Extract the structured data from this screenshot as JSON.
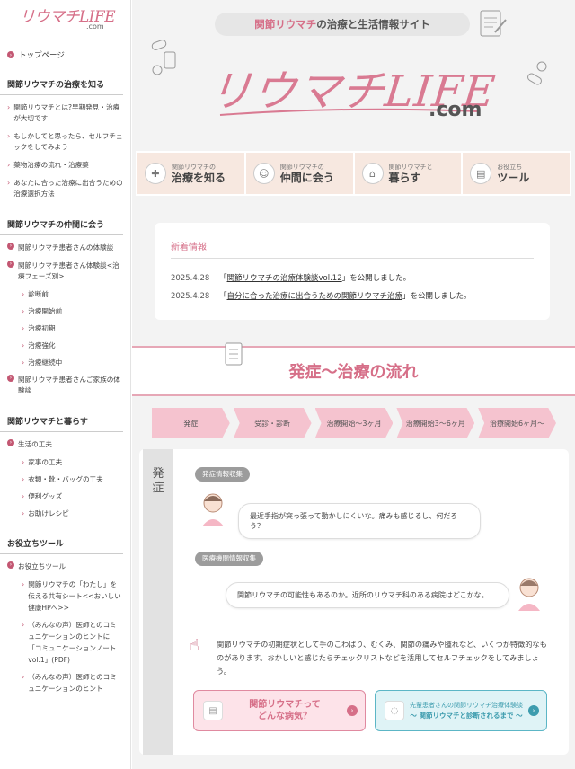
{
  "sidebar": {
    "logo": {
      "main": "リウマチLIFE",
      "suffix": ".com"
    },
    "top_link": "トップページ",
    "sections": [
      {
        "heading": "関節リウマチの治療を知る",
        "items": [
          "関節リウマチとは?早期発見・治療が大切です",
          "もしかしてと思ったら、セルフチェックをしてみよう",
          "薬物治療の流れ・治療薬",
          "あなたに合った治療に出合うための治療選択方法"
        ]
      },
      {
        "heading": "関節リウマチの仲間に会う",
        "dot_items": [
          "関節リウマチ患者さんの体験談",
          "関節リウマチ患者さん体験談<治療フェーズ別>"
        ],
        "sub_items": [
          "診断前",
          "治療開始前",
          "治療初期",
          "治療強化",
          "治療継続中"
        ],
        "dot_items_after": [
          "関節リウマチ患者さんご家族の体験談"
        ]
      },
      {
        "heading": "関節リウマチと暮らす",
        "dot_items": [
          "生活の工夫"
        ],
        "sub_items": [
          "家事の工夫",
          "衣類・靴・バッグの工夫",
          "便利グッズ",
          "お助けレシピ"
        ]
      },
      {
        "heading": "お役立ちツール",
        "dot_items": [
          "お役立ちツール"
        ],
        "sub_items": [
          "関節リウマチの「わたし」を伝える共有シート<<おいしい健康HPへ>>",
          "（みんなの声）医師とのコミュニケーションのヒントに「コミュニケーションノート vol.1」(PDF)",
          "（みんなの声）医師とのコミュニケーションのヒント"
        ]
      }
    ]
  },
  "header": {
    "tagline_pink": "関節リウマチ",
    "tagline_rest": "の治療と生活情報サイト",
    "logo_main": "リウマチLIFE",
    "logo_suffix": ".com"
  },
  "nav_tiles": [
    {
      "small": "関節リウマチの",
      "big": "治療を知る",
      "icon": "pill-icon"
    },
    {
      "small": "関節リウマチの",
      "big": "仲間に会う",
      "icon": "people-icon"
    },
    {
      "small": "関節リウマチと",
      "big": "暮らす",
      "icon": "house-icon"
    },
    {
      "small": "お役立ち",
      "big": "ツール",
      "icon": "document-icon"
    }
  ],
  "news": {
    "title": "新着情報",
    "items": [
      {
        "date": "2025.4.28",
        "open": "「",
        "link": "関節リウマチの治療体験談vol.12",
        "close": "」を公開しました。"
      },
      {
        "date": "2025.4.28",
        "open": "「",
        "link": "自分に合った治療に出合うための関節リウマチ治療",
        "close": "」を公開しました。"
      }
    ]
  },
  "flow": {
    "title": "発症〜治療の流れ",
    "steps": [
      "発症",
      "受診・診断",
      "治療開始〜3ヶ月",
      "治療開始3〜6ヶ月",
      "治療開始6ヶ月〜"
    ],
    "phase_label": "発症",
    "tag1": "発症情報収集",
    "bubble1": "最近手指が突っ張って動かしにくいな。痛みも感じるし、何だろう？",
    "tag2": "医療機関情報収集",
    "bubble2": "関節リウマチの可能性もあるのか。近所のリウマチ科のある病院はどこかな。",
    "info": "関節リウマチの初期症状として手のこわばり、むくみ、関節の痛みや腫れなど、いくつか特徴的なものがあります。おかしいと感じたらチェックリストなどを活用してセルフチェックをしてみましょう。",
    "btn_a": {
      "line1": "関節リウマチって",
      "line2": "どんな病気？"
    },
    "btn_b": {
      "line1": "先輩患者さんの関節リウマチ治療体験談",
      "line2": "〜 関節リウマチと診断されるまで 〜"
    }
  },
  "colors": {
    "accent": "#d66f88",
    "teal": "#3d9cae",
    "tile": "#f7e8e0",
    "step": "#f5c3cf"
  }
}
